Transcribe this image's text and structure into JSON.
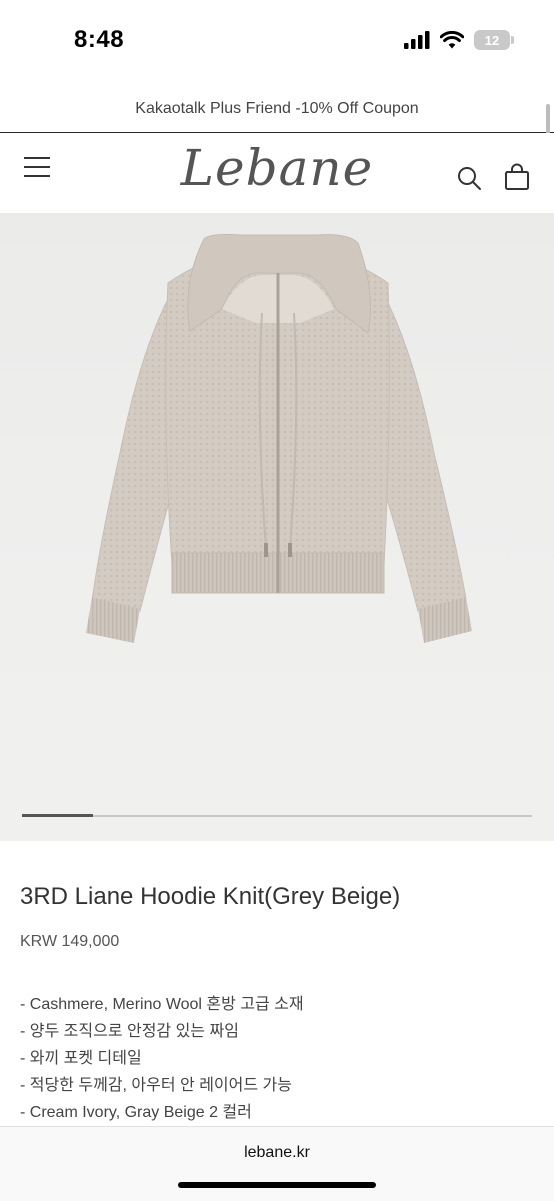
{
  "status_bar": {
    "time": "8:48",
    "battery": "12"
  },
  "promo": {
    "text": "Kakaotalk Plus Friend -10% Off Coupon"
  },
  "header": {
    "logo": "Lebane"
  },
  "carousel": {
    "position_fraction": 0.14
  },
  "product": {
    "title": "3RD Liane Hoodie Knit(Grey Beige)",
    "price": "KRW 149,000",
    "description": [
      "- Cashmere, Merino Wool 혼방 고급 소재",
      "- 양두 조직으로 안정감 있는 짜임",
      "- 와끼 포켓 디테일",
      "- 적당한 두께감, 아우터 안 레이어드 가능",
      "- Cream Ivory, Gray Beige 2 컬러"
    ]
  },
  "browser": {
    "url": "lebane.kr"
  },
  "colors": {
    "knit": "#d3cac1",
    "background": "#eeeeed"
  }
}
